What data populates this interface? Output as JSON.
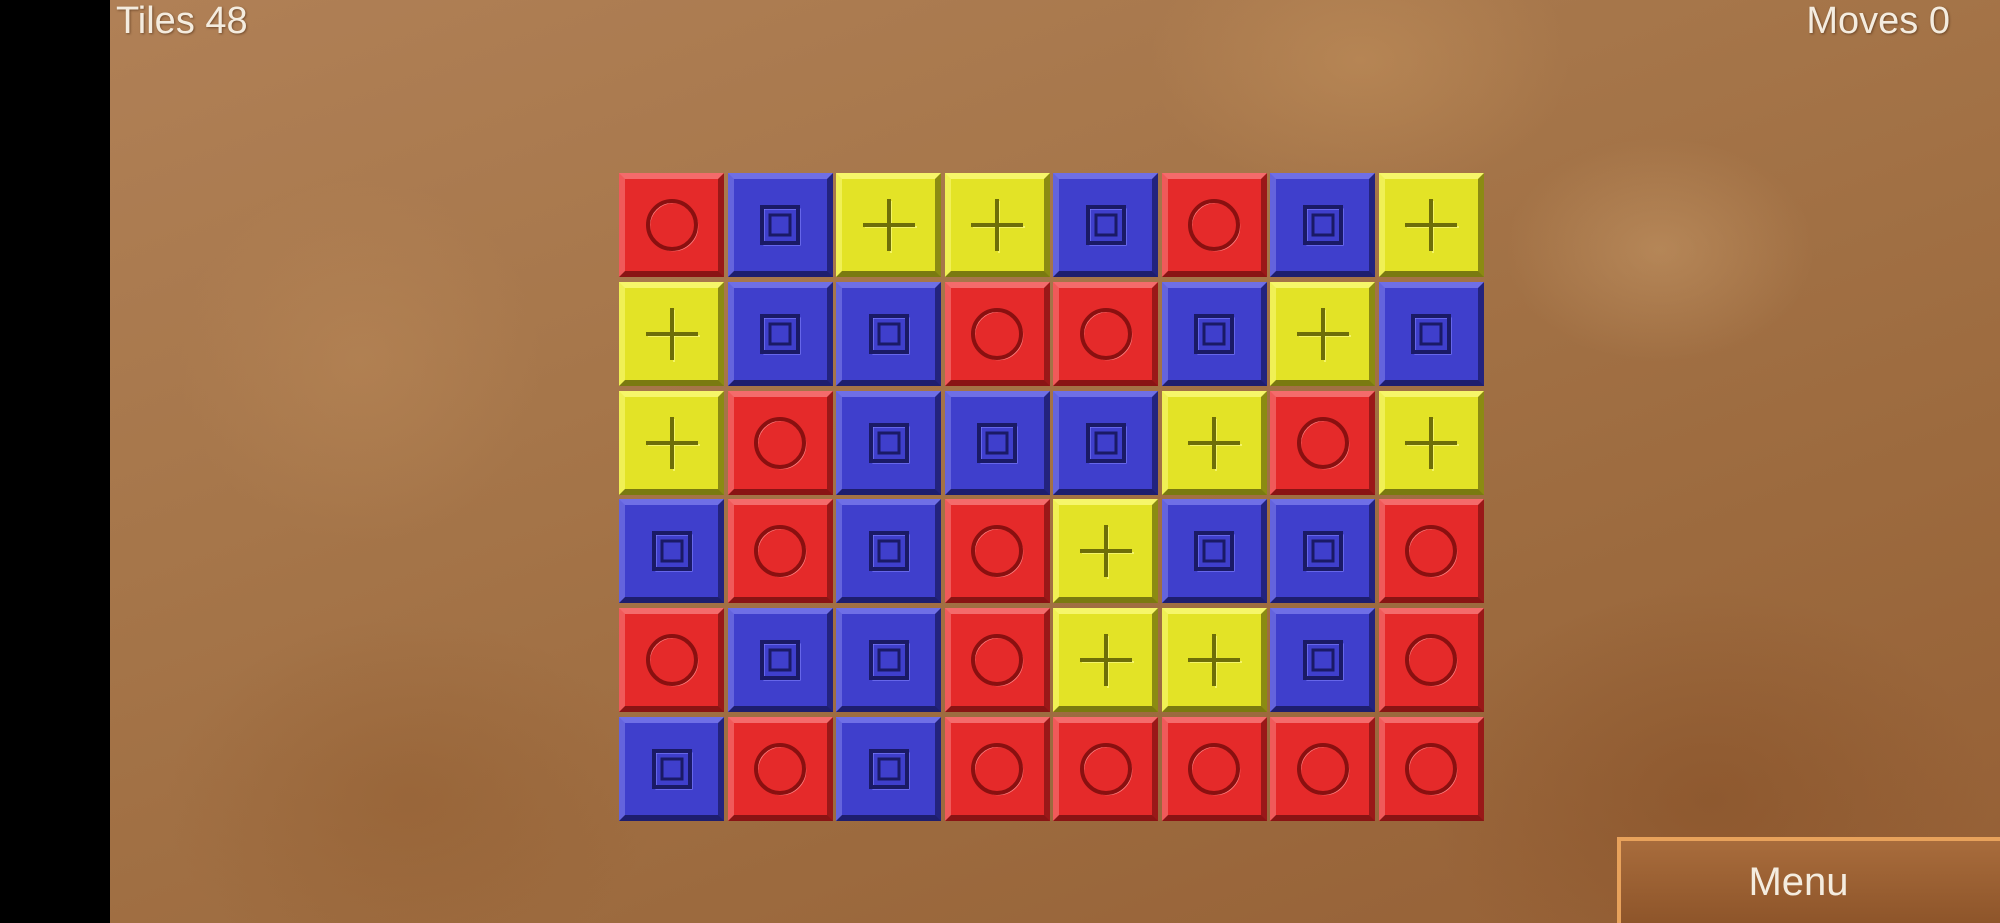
{
  "hud": {
    "tiles_label": "Tiles 48",
    "moves_label": "Moves 0"
  },
  "menu": {
    "label": "Menu"
  },
  "colors": {
    "red": "#e52a2a",
    "blue": "#3f3fcc",
    "yellow": "#e3e326"
  },
  "tile_symbols": {
    "red": "circle-icon",
    "blue": "square-icon",
    "yellow": "plus-icon"
  },
  "board": [
    [
      "red",
      "blue",
      "yellow",
      "yellow",
      "blue",
      "red",
      "blue",
      "yellow"
    ],
    [
      "yellow",
      "blue",
      "blue",
      "red",
      "red",
      "blue",
      "yellow",
      "blue"
    ],
    [
      "yellow",
      "red",
      "blue",
      "blue",
      "blue",
      "yellow",
      "red",
      "yellow"
    ],
    [
      "blue",
      "red",
      "blue",
      "red",
      "yellow",
      "blue",
      "blue",
      "red"
    ],
    [
      "red",
      "blue",
      "blue",
      "red",
      "yellow",
      "yellow",
      "blue",
      "red"
    ],
    [
      "blue",
      "red",
      "blue",
      "red",
      "red",
      "red",
      "red",
      "red"
    ]
  ]
}
